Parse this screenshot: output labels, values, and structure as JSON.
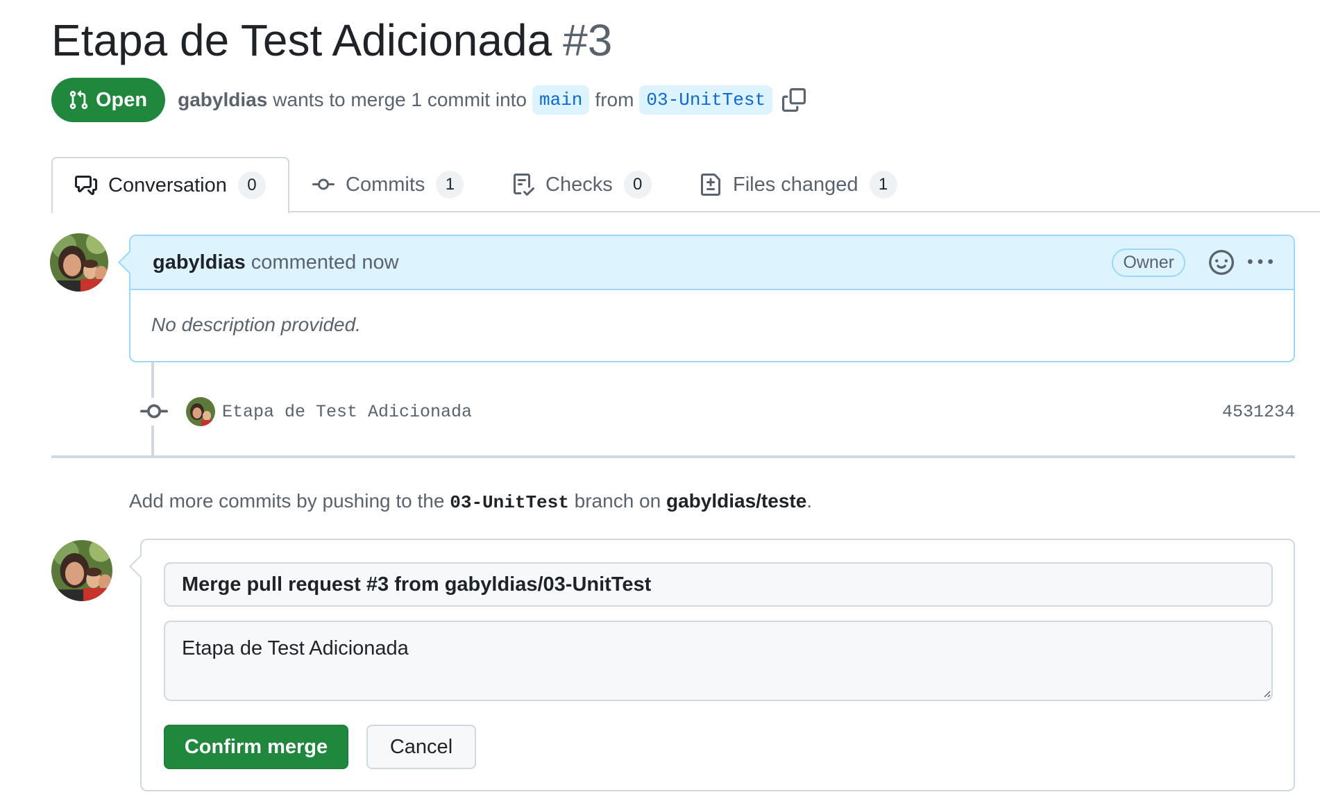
{
  "pr": {
    "title": "Etapa de Test Adicionada",
    "number": "#3",
    "state": "Open",
    "author": "gabyldias",
    "merge_text": "wants to merge 1 commit into",
    "base_branch": "main",
    "from_text": "from",
    "head_branch": "03-UnitTest"
  },
  "tabs": [
    {
      "label": "Conversation",
      "count": "0",
      "icon": "comment-discussion-icon"
    },
    {
      "label": "Commits",
      "count": "1",
      "icon": "git-commit-icon"
    },
    {
      "label": "Checks",
      "count": "0",
      "icon": "checklist-icon"
    },
    {
      "label": "Files changed",
      "count": "1",
      "icon": "file-diff-icon"
    }
  ],
  "comment": {
    "author": "gabyldias",
    "action": "commented now",
    "badge": "Owner",
    "body": "No description provided."
  },
  "commit": {
    "message": "Etapa de Test Adicionada",
    "sha": "4531234"
  },
  "hint": {
    "prefix": "Add more commits by pushing to the",
    "branch": "03-UnitTest",
    "middle": "branch on",
    "repo": "gabyldias/teste",
    "suffix": "."
  },
  "merge": {
    "title_value": "Merge pull request #3 from gabyldias/03-UnitTest",
    "body_value": "Etapa de Test Adicionada",
    "confirm_label": "Confirm merge",
    "cancel_label": "Cancel"
  },
  "colors": {
    "accent_green": "#1f883d",
    "branch_blue": "#0969da",
    "branch_bg": "#ddf4ff",
    "comment_header_bg": "#ddf4ff"
  }
}
